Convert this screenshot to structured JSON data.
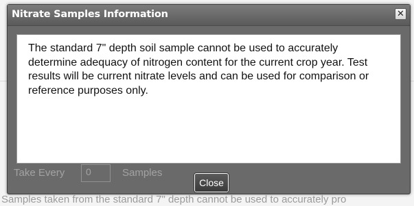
{
  "background": {
    "take_every_label": "Take Every",
    "take_every_value": "0",
    "samples_label": "Samples",
    "footer_text": "Samples taken from the standard 7\" depth cannot be used to accurately pro"
  },
  "dialog": {
    "title": "Nitrate Samples Information",
    "close_icon": "✕",
    "message": "The standard 7\" depth soil sample cannot be used to accurately determine adequacy of nitrogen content for the current crop year. Test results will be current nitrate levels and can be used for comparison or reference purposes only.",
    "close_button_label": "Close"
  },
  "colors": {
    "titlebar": "#6a6a6a",
    "content_background": "#ffffff",
    "button": "#444444"
  }
}
